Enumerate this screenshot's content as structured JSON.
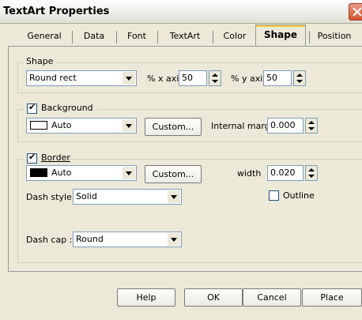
{
  "window": {
    "title": "TextArt Properties"
  },
  "tabs": [
    {
      "label": "General"
    },
    {
      "label": "Data"
    },
    {
      "label": "Font"
    },
    {
      "label": "TextArt"
    },
    {
      "label": "Color"
    },
    {
      "label": "Shape"
    },
    {
      "label": "Position"
    }
  ],
  "active_tab": "Shape",
  "shape_group": {
    "legend": "Shape",
    "shape_value": "Round rect",
    "x_axis_label": "% x axis",
    "x_axis_value": "50",
    "y_axis_label": "% y axis",
    "y_axis_value": "50"
  },
  "background_group": {
    "legend": "Background",
    "checked": true,
    "color_value": "Auto",
    "swatch_color": "#ffffff",
    "custom_label": "Custom...",
    "internal_margin_label": "Internal margin",
    "internal_margin_value": "0.000"
  },
  "border_group": {
    "legend": "Border",
    "checked": true,
    "color_value": "Auto",
    "swatch_color": "#000000",
    "custom_label": "Custom...",
    "width_label": "width",
    "width_value": "0.020",
    "outline_label": "Outline",
    "outline_checked": false,
    "dash_style_label": "Dash style :",
    "dash_style_value": "Solid",
    "dash_cap_label": "Dash cap :",
    "dash_cap_value": "Round"
  },
  "buttons": {
    "help": "Help",
    "ok": "OK",
    "cancel": "Cancel",
    "place": "Place"
  }
}
